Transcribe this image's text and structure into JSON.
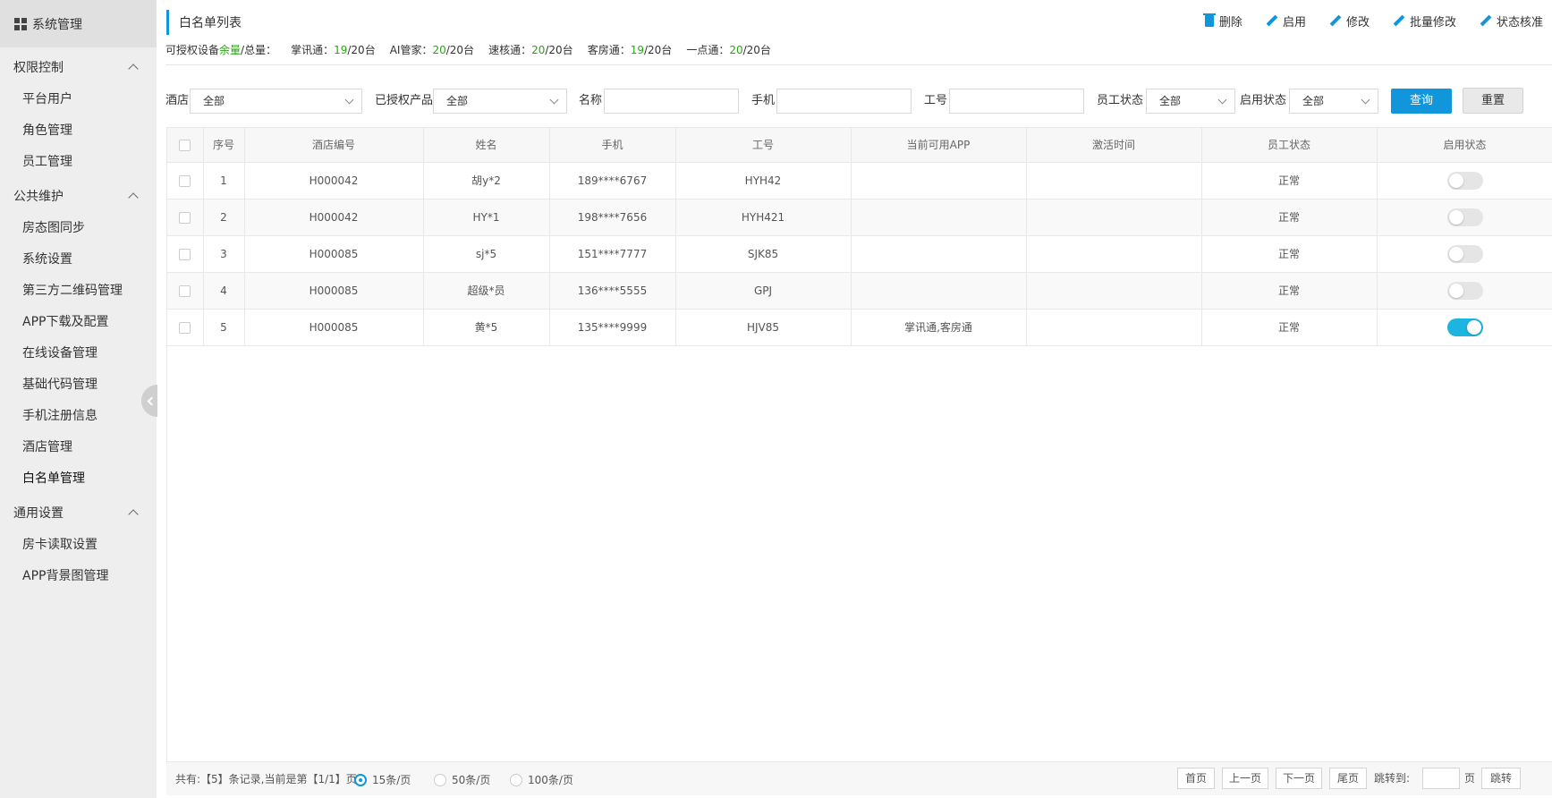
{
  "sidebar": {
    "title": "系统管理",
    "groups": [
      {
        "label": "权限控制",
        "items": [
          "平台用户",
          "角色管理",
          "员工管理"
        ]
      },
      {
        "label": "公共维护",
        "items": [
          "房态图同步",
          "系统设置",
          "第三方二维码管理",
          "APP下载及配置",
          "在线设备管理",
          "基础代码管理",
          "手机注册信息",
          "酒店管理",
          "白名单管理"
        ]
      },
      {
        "label": "通用设置",
        "items": [
          "房卡读取设置",
          "APP背景图管理"
        ]
      }
    ]
  },
  "header": {
    "title": "白名单列表",
    "quota": {
      "prefix": "可授权设备",
      "remain": "余量",
      "suffix": "/总量：",
      "items": [
        {
          "label": "掌讯通：",
          "used": "19",
          "total": "/20台"
        },
        {
          "label": "AI管家：",
          "used": "20",
          "total": "/20台"
        },
        {
          "label": "速核通：",
          "used": "20",
          "total": "/20台"
        },
        {
          "label": "客房通：",
          "used": "19",
          "total": "/20台"
        },
        {
          "label": "一点通：",
          "used": "20",
          "total": "/20台"
        }
      ]
    },
    "toolbar": {
      "delete": "删除",
      "enable": "启用",
      "edit": "修改",
      "batch_edit": "批量修改",
      "verify": "状态核准"
    }
  },
  "filters": {
    "hotel_label": "酒店",
    "hotel_value": "全部",
    "product_label": "已授权产品",
    "product_value": "全部",
    "name_label": "名称",
    "phone_label": "手机",
    "empno_label": "工号",
    "emp_status_label": "员工状态",
    "emp_status_value": "全部",
    "enable_status_label": "启用状态",
    "enable_status_value": "全部",
    "query": "查询",
    "reset": "重置"
  },
  "table": {
    "headers": [
      "序号",
      "酒店编号",
      "姓名",
      "手机",
      "工号",
      "当前可用APP",
      "激活时间",
      "员工状态",
      "启用状态"
    ],
    "rows": [
      {
        "no": "1",
        "hotel": "H000042",
        "name": "胡y*2",
        "phone": "189****6767",
        "empno": "HYH42",
        "app": "",
        "time": "",
        "status": "正常",
        "enabled": false
      },
      {
        "no": "2",
        "hotel": "H000042",
        "name": "HY*1",
        "phone": "198****7656",
        "empno": "HYH421",
        "app": "",
        "time": "",
        "status": "正常",
        "enabled": false
      },
      {
        "no": "3",
        "hotel": "H000085",
        "name": "sj*5",
        "phone": "151****7777",
        "empno": "SJK85",
        "app": "",
        "time": "",
        "status": "正常",
        "enabled": false
      },
      {
        "no": "4",
        "hotel": "H000085",
        "name": "超级*员",
        "phone": "136****5555",
        "empno": "GPJ",
        "app": "",
        "time": "",
        "status": "正常",
        "enabled": false
      },
      {
        "no": "5",
        "hotel": "H000085",
        "name": "黄*5",
        "phone": "135****9999",
        "empno": "HJV85",
        "app": "掌讯通,客房通",
        "time": "",
        "status": "正常",
        "enabled": true
      }
    ]
  },
  "pager": {
    "info": "共有:【5】条记录,当前是第【1/1】页",
    "size15": "15条/页",
    "size50": "50条/页",
    "size100": "100条/页",
    "first": "首页",
    "prev": "上一页",
    "next": "下一页",
    "last": "尾页",
    "jump_label": "跳转到:",
    "page_unit": "页",
    "jump": "跳转"
  },
  "colors": {
    "accent": "#1296db",
    "green": "#2aa515",
    "toggle_on": "#1cb5e0"
  }
}
